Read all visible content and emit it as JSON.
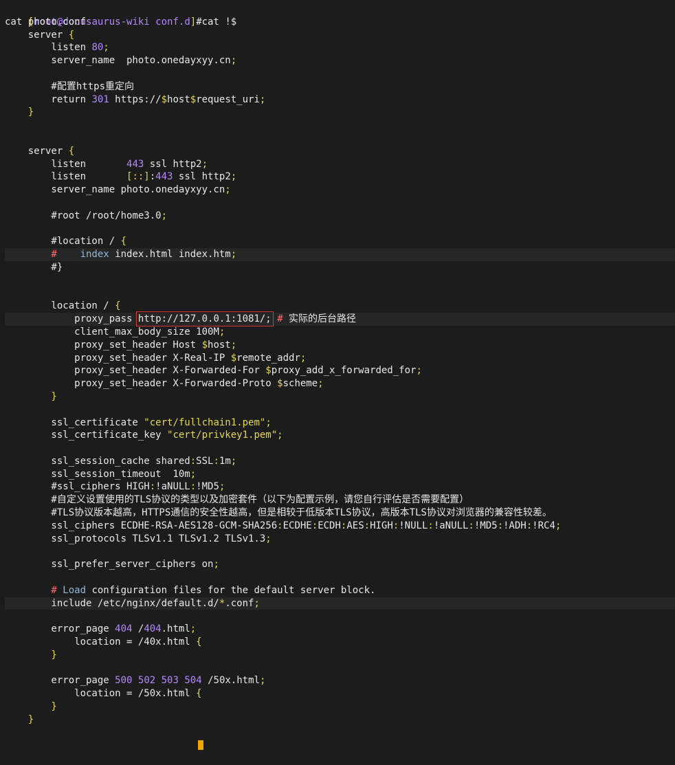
{
  "terminal": {
    "prompt": {
      "open": "[",
      "user_host": "root@docusaurus-wiki",
      "cwd": "conf.d",
      "close": "]",
      "command": "#cat !$"
    },
    "lines": [
      [
        {
          "t": "cat photo.conf",
          "c": "w"
        }
      ],
      [
        {
          "t": "    server ",
          "c": "w"
        },
        {
          "t": "{",
          "c": "y"
        }
      ],
      [
        {
          "t": "        listen ",
          "c": "w"
        },
        {
          "t": "80",
          "c": "p"
        },
        {
          "t": ";",
          "c": "y"
        }
      ],
      [
        {
          "t": "        server_name  photo.onedayxyy.cn",
          "c": "w"
        },
        {
          "t": ";",
          "c": "y"
        }
      ],
      [],
      [
        {
          "t": "        #配置https重定向",
          "c": "w"
        }
      ],
      [
        {
          "t": "        return ",
          "c": "w"
        },
        {
          "t": "301",
          "c": "p"
        },
        {
          "t": " https://",
          "c": "w"
        },
        {
          "t": "$",
          "c": "y"
        },
        {
          "t": "host",
          "c": "w"
        },
        {
          "t": "$",
          "c": "y"
        },
        {
          "t": "request_uri",
          "c": "w"
        },
        {
          "t": ";",
          "c": "y"
        }
      ],
      [
        {
          "t": "    }",
          "c": "y"
        }
      ],
      [],
      [],
      [
        {
          "t": "    server ",
          "c": "w"
        },
        {
          "t": "{",
          "c": "y"
        }
      ],
      [
        {
          "t": "        listen       ",
          "c": "w"
        },
        {
          "t": "443",
          "c": "p"
        },
        {
          "t": " ssl http2",
          "c": "w"
        },
        {
          "t": ";",
          "c": "y"
        }
      ],
      [
        {
          "t": "        listen       ",
          "c": "w"
        },
        {
          "t": "[::]",
          "c": "y"
        },
        {
          "t": ":",
          "c": "w"
        },
        {
          "t": "443",
          "c": "p"
        },
        {
          "t": " ssl http2",
          "c": "w"
        },
        {
          "t": ";",
          "c": "y"
        }
      ],
      [
        {
          "t": "        server_name photo.onedayxyy.cn",
          "c": "w"
        },
        {
          "t": ";",
          "c": "y"
        }
      ],
      [],
      [
        {
          "t": "        #root /root/home3.0",
          "c": "w"
        },
        {
          "t": ";",
          "c": "y"
        }
      ],
      [],
      [
        {
          "t": "        #location / ",
          "c": "w"
        },
        {
          "t": "{",
          "c": "y"
        }
      ],
      [
        {
          "t": "        #",
          "c": "r"
        },
        {
          "t": "    ",
          "c": "w"
        },
        {
          "t": "index",
          "c": "c"
        },
        {
          "t": " index.html index.htm",
          "c": "w"
        },
        {
          "t": ";",
          "c": "y"
        }
      ],
      [
        {
          "t": "        #}",
          "c": "w"
        }
      ],
      [],
      [],
      [
        {
          "t": "        location / ",
          "c": "w"
        },
        {
          "t": "{",
          "c": "y"
        }
      ],
      [
        {
          "t": "            proxy_pass ",
          "c": "w"
        },
        {
          "t": "http://127.0.0.1:1081/;",
          "c": "w",
          "box": true
        },
        {
          "t": " ",
          "c": "w"
        },
        {
          "t": "#",
          "c": "r"
        },
        {
          "t": " 实际的后台路径",
          "c": "w"
        }
      ],
      [
        {
          "t": "            client_max_body_size ",
          "c": "w"
        },
        {
          "t": "100M",
          "c": "w"
        },
        {
          "t": ";",
          "c": "y"
        }
      ],
      [
        {
          "t": "            proxy_set_header Host ",
          "c": "w"
        },
        {
          "t": "$",
          "c": "y"
        },
        {
          "t": "host",
          "c": "w"
        },
        {
          "t": ";",
          "c": "y"
        }
      ],
      [
        {
          "t": "            proxy_set_header X-Real-IP ",
          "c": "w"
        },
        {
          "t": "$",
          "c": "y"
        },
        {
          "t": "remote_addr",
          "c": "w"
        },
        {
          "t": ";",
          "c": "y"
        }
      ],
      [
        {
          "t": "            proxy_set_header X-Forwarded-For ",
          "c": "w"
        },
        {
          "t": "$",
          "c": "y"
        },
        {
          "t": "proxy_add_x_forwarded_for",
          "c": "w"
        },
        {
          "t": ";",
          "c": "y"
        }
      ],
      [
        {
          "t": "            proxy_set_header X-Forwarded-Proto ",
          "c": "w"
        },
        {
          "t": "$",
          "c": "y"
        },
        {
          "t": "scheme",
          "c": "w"
        },
        {
          "t": ";",
          "c": "y"
        }
      ],
      [
        {
          "t": "        }",
          "c": "y"
        }
      ],
      [],
      [
        {
          "t": "        ssl_certificate ",
          "c": "w"
        },
        {
          "t": "\"cert/fullchain1.pem\"",
          "c": "y"
        },
        {
          "t": ";",
          "c": "y"
        }
      ],
      [
        {
          "t": "        ssl_certificate_key ",
          "c": "w"
        },
        {
          "t": "\"cert/privkey1.pem\"",
          "c": "y"
        },
        {
          "t": ";",
          "c": "y"
        }
      ],
      [],
      [
        {
          "t": "        ssl_session_cache shared",
          "c": "w"
        },
        {
          "t": ":",
          "c": "y"
        },
        {
          "t": "SSL",
          "c": "w"
        },
        {
          "t": ":",
          "c": "y"
        },
        {
          "t": "1m",
          "c": "w"
        },
        {
          "t": ";",
          "c": "y"
        }
      ],
      [
        {
          "t": "        ssl_session_timeout  10m",
          "c": "w"
        },
        {
          "t": ";",
          "c": "y"
        }
      ],
      [
        {
          "t": "        #ssl_ciphers HIGH",
          "c": "w"
        },
        {
          "t": ":",
          "c": "y"
        },
        {
          "t": "!aNULL",
          "c": "w"
        },
        {
          "t": ":",
          "c": "y"
        },
        {
          "t": "!MD5",
          "c": "w"
        },
        {
          "t": ";",
          "c": "y"
        }
      ],
      [
        {
          "t": "        #自定义设置使用的TLS协议的类型以及加密套件（以下为配置示例，请您自行评估是否需要配置）",
          "c": "w"
        }
      ],
      [
        {
          "t": "        #TLS协议版本越高，HTTPS通信的安全性越高，但是相较于低版本TLS协议，高版本TLS协议对浏览器的兼容性较差。",
          "c": "w"
        }
      ],
      [
        {
          "t": "        ssl_ciphers ECDHE-RSA-AES128-GCM-SHA256",
          "c": "w"
        },
        {
          "t": ":",
          "c": "y"
        },
        {
          "t": "ECDHE",
          "c": "w"
        },
        {
          "t": ":",
          "c": "y"
        },
        {
          "t": "ECDH",
          "c": "w"
        },
        {
          "t": ":",
          "c": "y"
        },
        {
          "t": "AES",
          "c": "w"
        },
        {
          "t": ":",
          "c": "y"
        },
        {
          "t": "HIGH",
          "c": "w"
        },
        {
          "t": ":",
          "c": "y"
        },
        {
          "t": "!NULL",
          "c": "w"
        },
        {
          "t": ":",
          "c": "y"
        },
        {
          "t": "!aNULL",
          "c": "w"
        },
        {
          "t": ":",
          "c": "y"
        },
        {
          "t": "!MD5",
          "c": "w"
        },
        {
          "t": ":",
          "c": "y"
        },
        {
          "t": "!ADH",
          "c": "w"
        },
        {
          "t": ":",
          "c": "y"
        },
        {
          "t": "!RC4",
          "c": "w"
        },
        {
          "t": ";",
          "c": "y"
        }
      ],
      [
        {
          "t": "        ssl_protocols TLSv1.1 TLSv1.2 TLSv1.3",
          "c": "w"
        },
        {
          "t": ";",
          "c": "y"
        }
      ],
      [],
      [
        {
          "t": "        ssl_prefer_server_ciphers on",
          "c": "w"
        },
        {
          "t": ";",
          "c": "y"
        }
      ],
      [],
      [
        {
          "t": "        # ",
          "c": "r"
        },
        {
          "t": "Load",
          "c": "c"
        },
        {
          "t": " configuration files for the default server block.",
          "c": "w"
        }
      ],
      [
        {
          "t": "        include /etc/nginx/default.d/",
          "c": "w"
        },
        {
          "t": "*",
          "c": "y"
        },
        {
          "t": ".conf",
          "c": "w"
        },
        {
          "t": ";",
          "c": "y"
        }
      ],
      [],
      [
        {
          "t": "        error_page ",
          "c": "w"
        },
        {
          "t": "404",
          "c": "p"
        },
        {
          "t": " /",
          "c": "w"
        },
        {
          "t": "404",
          "c": "p"
        },
        {
          "t": ".html",
          "c": "w"
        },
        {
          "t": ";",
          "c": "y"
        }
      ],
      [
        {
          "t": "            location = /40x.html ",
          "c": "w"
        },
        {
          "t": "{",
          "c": "y"
        }
      ],
      [
        {
          "t": "        }",
          "c": "y"
        }
      ],
      [],
      [
        {
          "t": "        error_page ",
          "c": "w"
        },
        {
          "t": "500",
          "c": "p"
        },
        {
          "t": " ",
          "c": "w"
        },
        {
          "t": "502",
          "c": "p"
        },
        {
          "t": " ",
          "c": "w"
        },
        {
          "t": "503",
          "c": "p"
        },
        {
          "t": " ",
          "c": "w"
        },
        {
          "t": "504",
          "c": "p"
        },
        {
          "t": " /50x.html",
          "c": "w"
        },
        {
          "t": ";",
          "c": "y"
        }
      ],
      [
        {
          "t": "            location = /50x.html ",
          "c": "w"
        },
        {
          "t": "{",
          "c": "y"
        }
      ],
      [
        {
          "t": "        }",
          "c": "y"
        }
      ],
      [
        {
          "t": "    }",
          "c": "y"
        }
      ]
    ],
    "highlighted_lines": [
      18,
      23,
      45
    ],
    "colors": {
      "background": "#1c1c1c",
      "text": "#e8e8e8",
      "yellow": "#e5d84e",
      "purple": "#b388ff",
      "cyan": "#8fb8d8",
      "red": "#ff6b6b",
      "box": "#dd3333",
      "cursor": "#f0a500"
    }
  }
}
